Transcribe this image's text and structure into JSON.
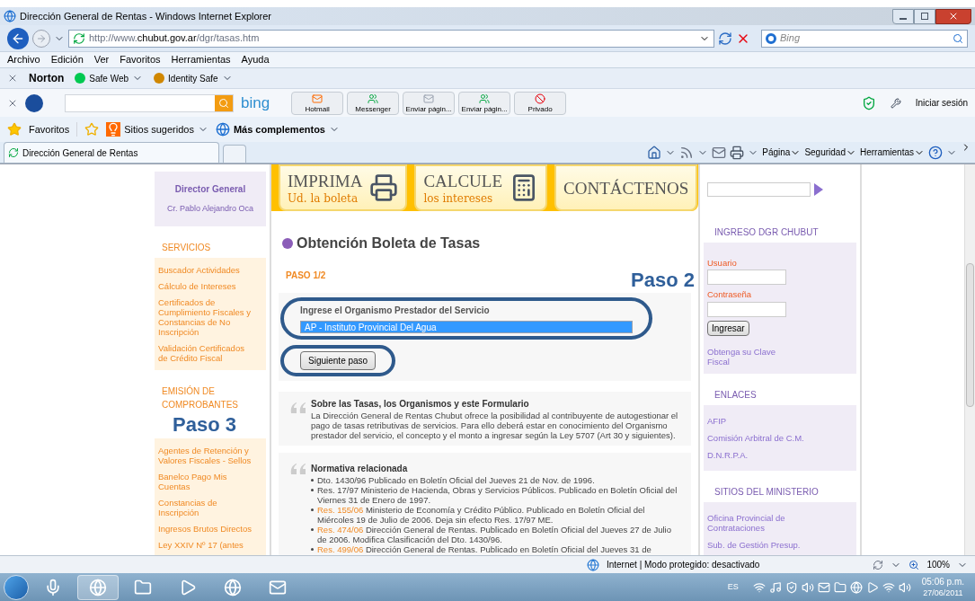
{
  "window": {
    "title": "Dirección General de Rentas - Windows Internet Explorer"
  },
  "address_bar": {
    "url_prefix": "http://www.",
    "url_domain": "chubut.gov.ar",
    "url_path": "/dgr/tasas.htm"
  },
  "search": {
    "placeholder": "Bing"
  },
  "menu": [
    "Archivo",
    "Edición",
    "Ver",
    "Favoritos",
    "Herramientas",
    "Ayuda"
  ],
  "norton_toolbar": {
    "brand": "Norton",
    "items": [
      "Safe Web",
      "Identity Safe"
    ]
  },
  "hp_toolbar": {
    "search_brand": "bing",
    "buttons": [
      "Hotmail",
      "Messenger",
      "Enviar págin...",
      "Enviar págin...",
      "Privado"
    ],
    "sign_in": "Iniciar sesión"
  },
  "favorites_bar": {
    "favorites": "Favoritos",
    "items": [
      {
        "label": "Sitios sugeridos",
        "bold": false
      },
      {
        "label": "Más complementos",
        "bold": true
      }
    ]
  },
  "tab": {
    "label": "Dirección General de Rentas"
  },
  "command_bar": [
    "Página",
    "Seguridad",
    "Herramientas"
  ],
  "banners": [
    {
      "title": "IMPRIMA",
      "subtitle": "Ud. la boleta",
      "kind": "printer"
    },
    {
      "title": "CALCULE",
      "subtitle": "los intereses",
      "kind": "calculator"
    },
    {
      "title": "CONTÁCTENOS",
      "kind": "plain"
    }
  ],
  "left_sidebar": {
    "director": {
      "title": "Director General",
      "name": "Cr. Pablo Alejandro Oca"
    },
    "sections": [
      {
        "heading": "SERVICIOS",
        "items": [
          "Buscador Actividades",
          "Cálculo de Intereses",
          "Certificados de Cumplimiento Fiscales y Constancias de No Inscripción",
          "Validación Certificados de Crédito Fiscal"
        ]
      },
      {
        "heading": "EMISIÓN DE COMPROBANTES",
        "items": [
          "Agentes de Retención y Valores Fiscales - Sellos",
          "Banelco Pago Mis Cuentas",
          "Constancias de Inscripción",
          "Ingresos Brutos Directos",
          "Ley XXIV Nº 17 (antes"
        ]
      }
    ]
  },
  "main": {
    "title": "Obtención Boleta de Tasas",
    "step": "PASO 1/2",
    "form": {
      "label": "Ingrese el Organismo Prestador del Servicio",
      "value": "AP - Instituto Provincial Del Agua",
      "button": "Siguiente paso"
    },
    "info": {
      "title": "Sobre las Tasas, los Organismos y este Formulario",
      "text": "La Dirección General de Rentas Chubut ofrece la posibilidad al contribuyente de autogestionar el pago de tasas retributivas de servicios. Para ello deberá estar en conocimiento del Organismo prestador del servicio, el concepto y el monto a ingresar según la Ley 5707 (Art 30 y siguientes)."
    },
    "normativa": {
      "title": "Normativa relacionada",
      "items": [
        {
          "text": "Dto. 1430/96 Publicado en Boletín Oficial del Jueves 21 de Nov. de 1996."
        },
        {
          "text": "Res. 17/97 Ministerio de Hacienda, Obras y Servicios Públicos. Publicado en Boletín Oficial del Viernes 31 de Enero de 1997."
        },
        {
          "link": "Res. 155/06",
          "text": "Ministerio de Economía y Crédito Público. Publicado en Boletín Oficial del Miércoles 19 de Julio de 2006. Deja sin efecto Res. 17/97 ME."
        },
        {
          "link": "Res. 474/06",
          "text": "Dirección General de Rentas. Publicado en Boletín Oficial del Jueves 27 de Julio de 2006. Modifica Clasificación del Dto. 1430/96."
        },
        {
          "link": "Res. 499/06",
          "text": "Dirección General de Rentas. Publicado en Boletín Oficial del Jueves 31 de"
        }
      ]
    }
  },
  "right_sidebar": {
    "login": {
      "heading": "INGRESO DGR CHUBUT",
      "user_label": "Usuario",
      "password_label": "Contraseña",
      "button": "Ingresar",
      "link": "Obtenga su Clave Fiscal"
    },
    "sections": [
      {
        "heading": "ENLACES",
        "items": [
          "AFIP",
          "Comisión Arbitral de C.M.",
          "D.N.R.P.A."
        ]
      },
      {
        "heading": "SITIOS DEL MINISTERIO",
        "items": [
          "Oficina Provincial de Contrataciones",
          "Sub. de Gestión Presup."
        ]
      }
    ]
  },
  "annotations": {
    "step2": "Paso 2",
    "step3": "Paso 3"
  },
  "status_bar": {
    "zone": "Internet | Modo protegido: desactivado",
    "zoom": "100%"
  },
  "taskbar": {
    "language": "ES",
    "time": "05:06 p.m.",
    "date": "27/06/2011"
  }
}
